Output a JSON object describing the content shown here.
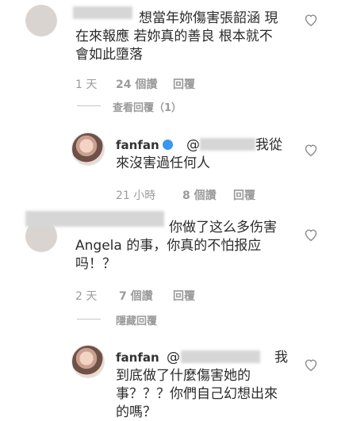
{
  "comments": [
    {
      "text_lines": [
        "想當年妳傷害張韶涵 現",
        "在來報應 若妳真的善良 根本就不",
        "會如此墮落"
      ],
      "time": "1 天",
      "likes": "24 個讚",
      "reply": "回覆",
      "view_replies": "查看回覆（1）"
    },
    {
      "username": "fanfan",
      "mention": "@",
      "text_lines": [
        "我從",
        "來沒害過任何人"
      ],
      "time": "21 小時",
      "likes": "8 個讚",
      "reply": "回覆"
    },
    {
      "text_lines": [
        "你做了这么多伤害",
        "Angela 的事，你真的不怕报应",
        "吗！？"
      ],
      "time": "2 天",
      "likes": "7 個讚",
      "reply": "回覆",
      "hide_replies": "隱藏回覆"
    },
    {
      "username": "fanfan",
      "mention": "@",
      "text_lines": [
        "我",
        "到底做了什麼傷害她的",
        "事？？？你們自己幻想出來",
        "的嗎？"
      ]
    }
  ],
  "icons": {
    "like": "heart-icon",
    "verified": "verified-badge-icon"
  }
}
